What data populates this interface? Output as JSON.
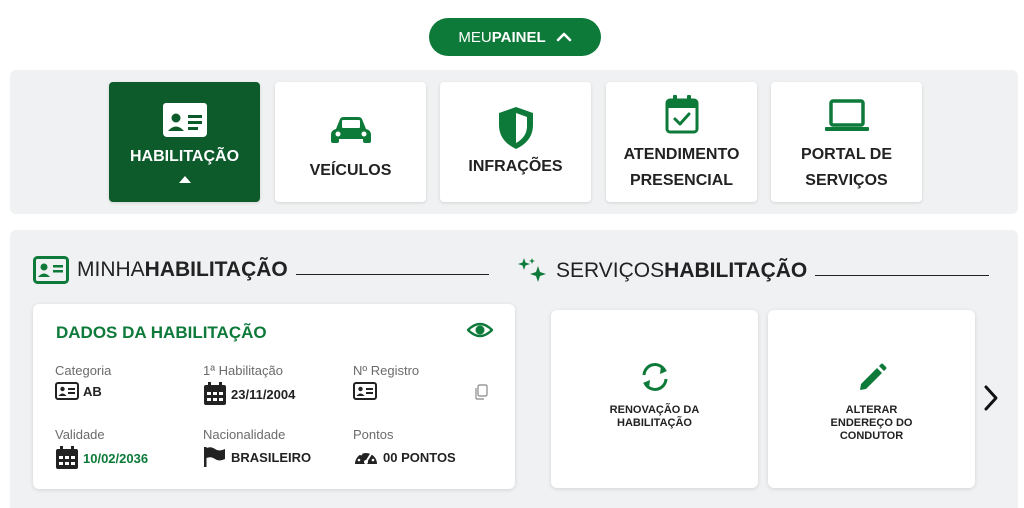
{
  "painel": {
    "prefix": "MEU",
    "bold": "PAINEL"
  },
  "tiles": [
    {
      "label": "HABILITAÇÃO",
      "icon": "id-card-icon",
      "active": true
    },
    {
      "label": "VEÍCULOS",
      "icon": "car-icon"
    },
    {
      "label": "INFRAÇÕES",
      "icon": "shield-icon"
    },
    {
      "label_l1": "ATENDIMENTO",
      "label_l2": "PRESENCIAL",
      "icon": "calendar-check-icon"
    },
    {
      "label_l1": "PORTAL DE",
      "label_l2": "SERVIÇOS",
      "icon": "laptop-icon"
    }
  ],
  "minha": {
    "prefix": "MINHA",
    "bold": "HABILITAÇÃO",
    "icon": "id-card-icon"
  },
  "servicos": {
    "prefix": "SERVIÇOS",
    "bold": "HABILITAÇÃO",
    "icon": "sparkle-icon"
  },
  "card": {
    "title": "DADOS DA HABILITAÇÃO",
    "categoria": {
      "label": "Categoria",
      "value": "AB"
    },
    "primeira": {
      "label": "1ª Habilitação",
      "value": "23/11/2004"
    },
    "registro": {
      "label": "Nº Registro",
      "value": ""
    },
    "validade": {
      "label": "Validade",
      "value": "10/02/2036"
    },
    "nacionalidade": {
      "label": "Nacionalidade",
      "value": "BRASILEIRO"
    },
    "pontos": {
      "label": "Pontos",
      "value": "00 PONTOS"
    }
  },
  "services": [
    {
      "l1": "RENOVAÇÃO DA",
      "l2": "HABILITAÇÃO",
      "icon": "refresh-icon"
    },
    {
      "l1": "ALTERAR",
      "l2": "ENDEREÇO DO",
      "l3": "CONDUTOR",
      "icon": "pencil-icon"
    }
  ],
  "colors": {
    "primary": "#0e7a3a",
    "dark": "#0d5a2a",
    "bg": "#f0f1f2"
  }
}
